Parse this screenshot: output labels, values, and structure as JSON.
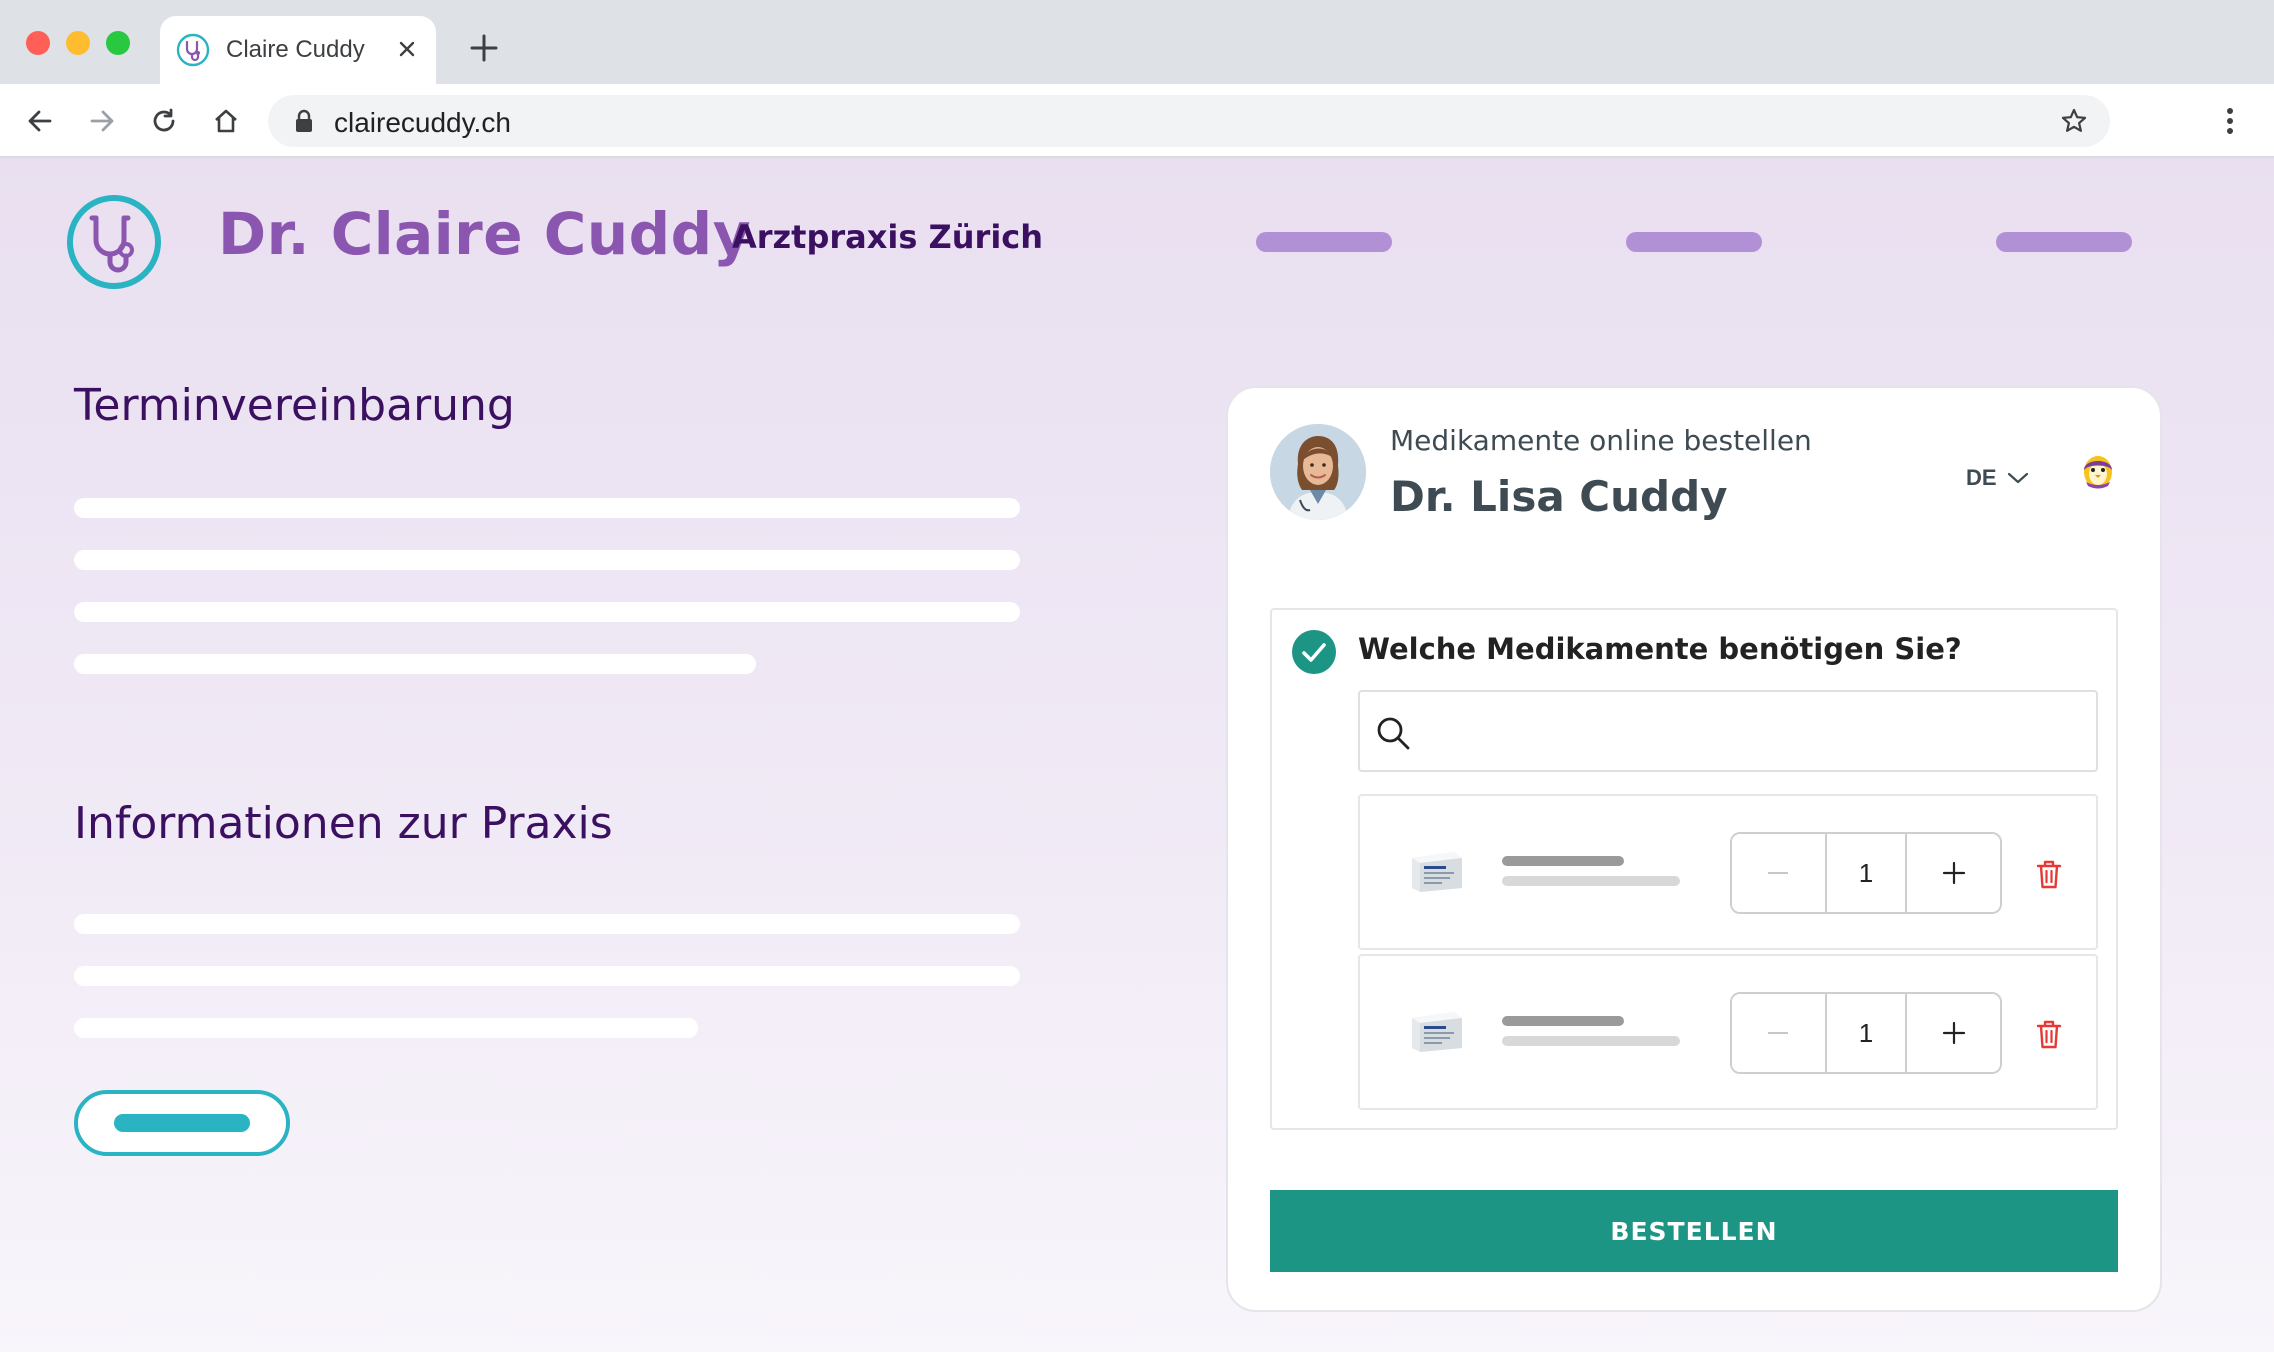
{
  "browser": {
    "tab_title": "Claire Cuddy",
    "url": "clairecuddy.ch",
    "icons": {
      "close": "close-icon",
      "new_tab": "plus-icon",
      "back": "arrow-left-icon",
      "forward": "arrow-right-icon",
      "reload": "reload-icon",
      "home": "home-icon",
      "lock": "lock-icon",
      "bookmark": "star-icon",
      "menu": "kebab-menu-icon"
    }
  },
  "site": {
    "title": "Dr. Claire Cuddy",
    "subtitle": "Arztpraxis Zürich",
    "sections": [
      {
        "heading": "Terminvereinbarung"
      },
      {
        "heading": "Informationen zur Praxis"
      }
    ]
  },
  "widget": {
    "kicker": "Medikamente online bestellen",
    "doctor_name": "Dr. Lisa Cuddy",
    "language": "DE",
    "question": "Welche Medikamente benötigen Sie?",
    "search_placeholder": "",
    "items": [
      {
        "quantity": "1"
      },
      {
        "quantity": "1"
      }
    ],
    "order_label": "BESTELLEN"
  },
  "colors": {
    "brand_purple": "#8a56b0",
    "brand_dark": "#3b1060",
    "accent_teal": "#2ab3c3",
    "order_green": "#1c9585",
    "delete_red": "#e53935"
  }
}
